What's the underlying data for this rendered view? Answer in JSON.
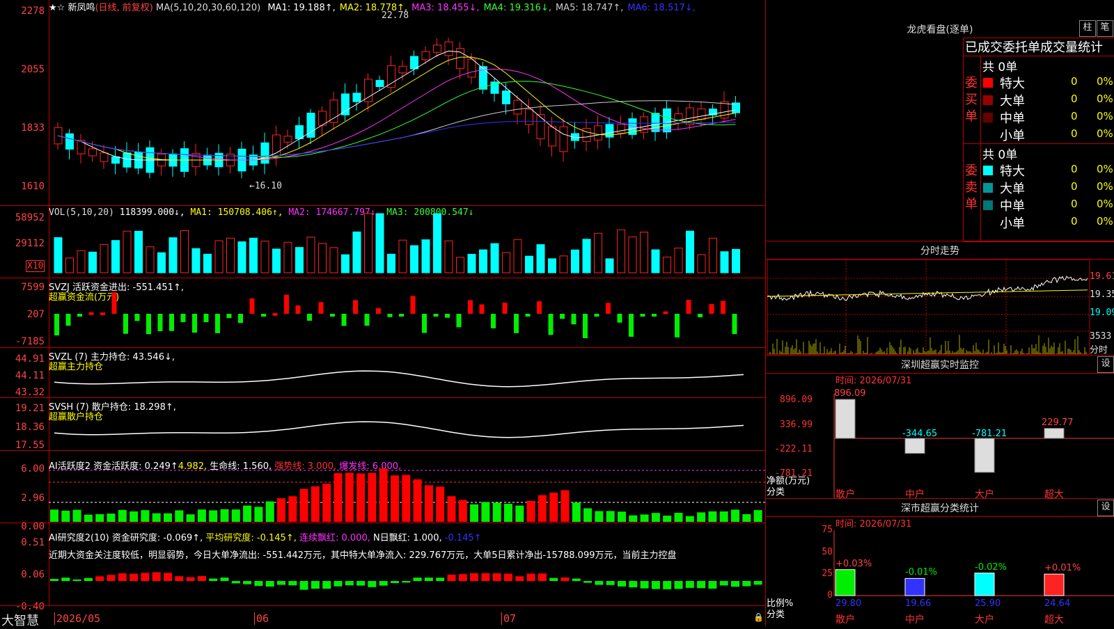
{
  "header": {
    "stock_name": "新凤鸣",
    "period": "(日线, 前复权)",
    "ma_params": "MA(5,10,20,30,60,120)",
    "ma_values": [
      {
        "label": "MA1:",
        "value": "19.188",
        "arrow": "↑",
        "color": "#ffffff"
      },
      {
        "label": "MA2:",
        "value": "18.778",
        "arrow": "↑",
        "color": "#ffff00"
      },
      {
        "label": "MA3:",
        "value": "18.455",
        "arrow": "↓",
        "color": "#ff33ff"
      },
      {
        "label": "MA4:",
        "value": "19.316",
        "arrow": "↓",
        "color": "#33ff33"
      },
      {
        "label": "MA5:",
        "value": "18.747",
        "arrow": "↑",
        "color": "#cccccc"
      },
      {
        "label": "MA6:",
        "value": "18.517",
        "arrow": "↓",
        "color": "#3333ff"
      }
    ]
  },
  "price_axis": [
    "2278",
    "2055",
    "1833",
    "1610"
  ],
  "price_annotations": {
    "high": "22.78",
    "low": "←16.10"
  },
  "vol": {
    "title": "VOL(5,10,20)",
    "value": "118399.000↓,",
    "ma1": "MA1: 150708.406↑,",
    "ma2": "MA2: 174667.797↓,",
    "ma3": "MA3: 200800.547↓",
    "axis": [
      "58952",
      "29112"
    ],
    "unit": "X10"
  },
  "svzj": {
    "title": "SVZJ  活跃资金进出: -551.451↑,",
    "subtitle": "超赢资金流(万元)",
    "axis": [
      "7599",
      "207",
      "-7185"
    ]
  },
  "svzl": {
    "title": "SVZL (7) 主力持仓: 43.546↓,",
    "subtitle": "超赢主力持仓",
    "axis": [
      "44.91",
      "44.11",
      "43.32"
    ]
  },
  "svsh": {
    "title": "SVSH (7) 散户持仓: 18.298↑,",
    "subtitle": "超赢散户持仓",
    "axis": [
      "19.21",
      "18.36",
      "17.55"
    ]
  },
  "ai2": {
    "t1": "AI活跃度2 资金活跃度: 0.249↑",
    "t2": "4.982,",
    "t3": "生命线: 1.560,",
    "t4": "强势线: 3.000,",
    "t5": "爆发线: 6.000,",
    "axis": [
      "6.00",
      "2.96",
      "0.00"
    ]
  },
  "ai_research": {
    "t1": "AI研究度2(10) 资金研究度: -0.069↑,",
    "t2": "平均研究度: -0.145↑,",
    "t3": "连续飘红: 0.000,",
    "t4": "N日飘红: 1.000,",
    "t5": "-0.145↑",
    "comment": "近期大资金关注度较低，明显弱势，今日大单净流出: -551.442万元，其中特大单净流入: 229.767万元，大单5日累计净出-15788.099万元，当前主力控盘",
    "axis": [
      "0.51",
      "0.06",
      "-0.40"
    ]
  },
  "date_axis": {
    "brand": "大智慧",
    "d1": "2026/05",
    "d2": "06",
    "d3": "07"
  },
  "dragon": {
    "title": "龙虎看盘(逐单)",
    "btn1": "柱",
    "btn2": "笔",
    "heading": "已成交委托单成交量统计",
    "buy_side": "委买单",
    "sell_side": "委卖单",
    "buy_total": "共 0单",
    "sell_total": "共 0单",
    "buy_rows": [
      {
        "name": "特大",
        "v": "0",
        "p": "0%",
        "color": "#ff0000"
      },
      {
        "name": "大单",
        "v": "0",
        "p": "0%",
        "color": "#990000"
      },
      {
        "name": "中单",
        "v": "0",
        "p": "0%",
        "color": "#660000"
      },
      {
        "name": "小单",
        "v": "0",
        "p": "0%",
        "color": "#000000"
      }
    ],
    "sell_rows": [
      {
        "name": "特大",
        "v": "0",
        "p": "0%",
        "color": "#00ffff"
      },
      {
        "name": "大单",
        "v": "0",
        "p": "0%",
        "color": "#009999"
      },
      {
        "name": "中单",
        "v": "0",
        "p": "0%",
        "color": "#007777"
      },
      {
        "name": "小单",
        "v": "0",
        "p": "0%",
        "color": "#000000"
      }
    ]
  },
  "intraday": {
    "title": "分时走势",
    "axis": [
      "19.61",
      "19.35",
      "19.09"
    ],
    "vol_axis": [
      "3533",
      "分时"
    ]
  },
  "monitor": {
    "title": "深圳超赢实时监控",
    "btn": "设",
    "time": "时间: 2026/07/31",
    "axis": [
      "896.09",
      "336.99",
      "-222.11",
      "-781.21"
    ],
    "ylabel1": "净额(万元)",
    "ylabel2": "分类",
    "bars": [
      {
        "name": "散户",
        "value": "896.09"
      },
      {
        "name": "中户",
        "value": "-344.65"
      },
      {
        "name": "大户",
        "value": "-781.21"
      },
      {
        "name": "超大",
        "value": "229.77"
      }
    ]
  },
  "classify": {
    "title": "深市超赢分类统计",
    "btn": "设",
    "time": "时间: 2026/07/31",
    "axis": [
      "75",
      "50",
      "25",
      "0"
    ],
    "ylabel1": "比例%",
    "ylabel2": "分类",
    "bars": [
      {
        "name": "散户",
        "pct": "+0.03%",
        "value": "29.80"
      },
      {
        "name": "中户",
        "pct": "-0.01%",
        "value": "19.66"
      },
      {
        "name": "大户",
        "pct": "-0.02%",
        "value": "25.90"
      },
      {
        "name": "超大",
        "pct": "+0.01%",
        "value": "24.64"
      }
    ]
  }
}
